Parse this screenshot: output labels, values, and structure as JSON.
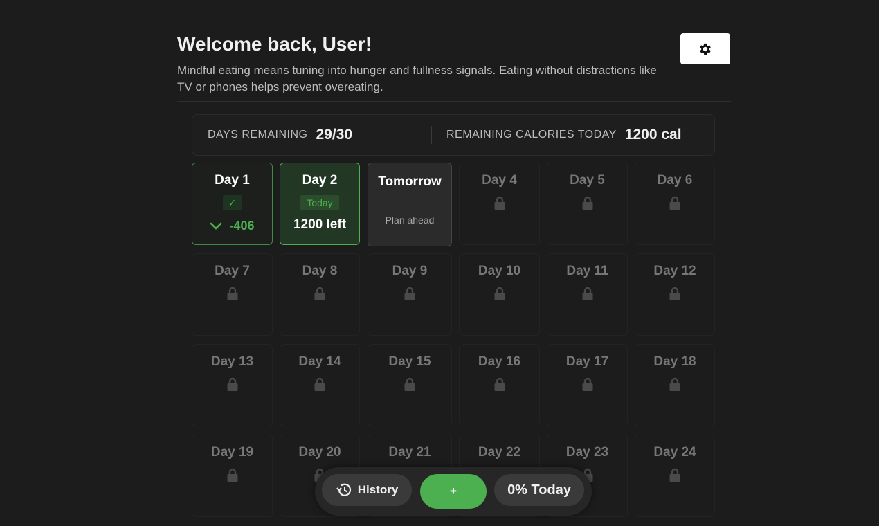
{
  "header": {
    "welcome": "Welcome back, User!",
    "tip": "Mindful eating means tuning into hunger and fullness signals. Eating without distractions like TV or phones helps prevent overeating.",
    "settings_icon": "gear-icon"
  },
  "stats": {
    "days_label": "DAYS REMAINING",
    "days_value": "29/30",
    "calories_label": "REMAINING CALORIES TODAY",
    "calories_value": "1200 cal"
  },
  "days": {
    "d1": {
      "label": "Day 1",
      "check": "✓",
      "delta": "-406"
    },
    "d2": {
      "label": "Day 2",
      "badge": "Today",
      "left": "1200 left"
    },
    "d3": {
      "label": "Tomorrow",
      "sub": "Plan ahead"
    },
    "locked": [
      "Day 4",
      "Day 5",
      "Day 6",
      "Day 7",
      "Day 8",
      "Day 9",
      "Day 10",
      "Day 11",
      "Day 12",
      "Day 13",
      "Day 14",
      "Day 15",
      "Day 16",
      "Day 17",
      "Day 18",
      "Day 19",
      "Day 20",
      "Day 21",
      "Day 22",
      "Day 23",
      "Day 24"
    ]
  },
  "bottom": {
    "history": "History",
    "add": "+",
    "progress": "0% Today"
  },
  "colors": {
    "accent": "#4caf50",
    "background": "#1c1c1c"
  }
}
